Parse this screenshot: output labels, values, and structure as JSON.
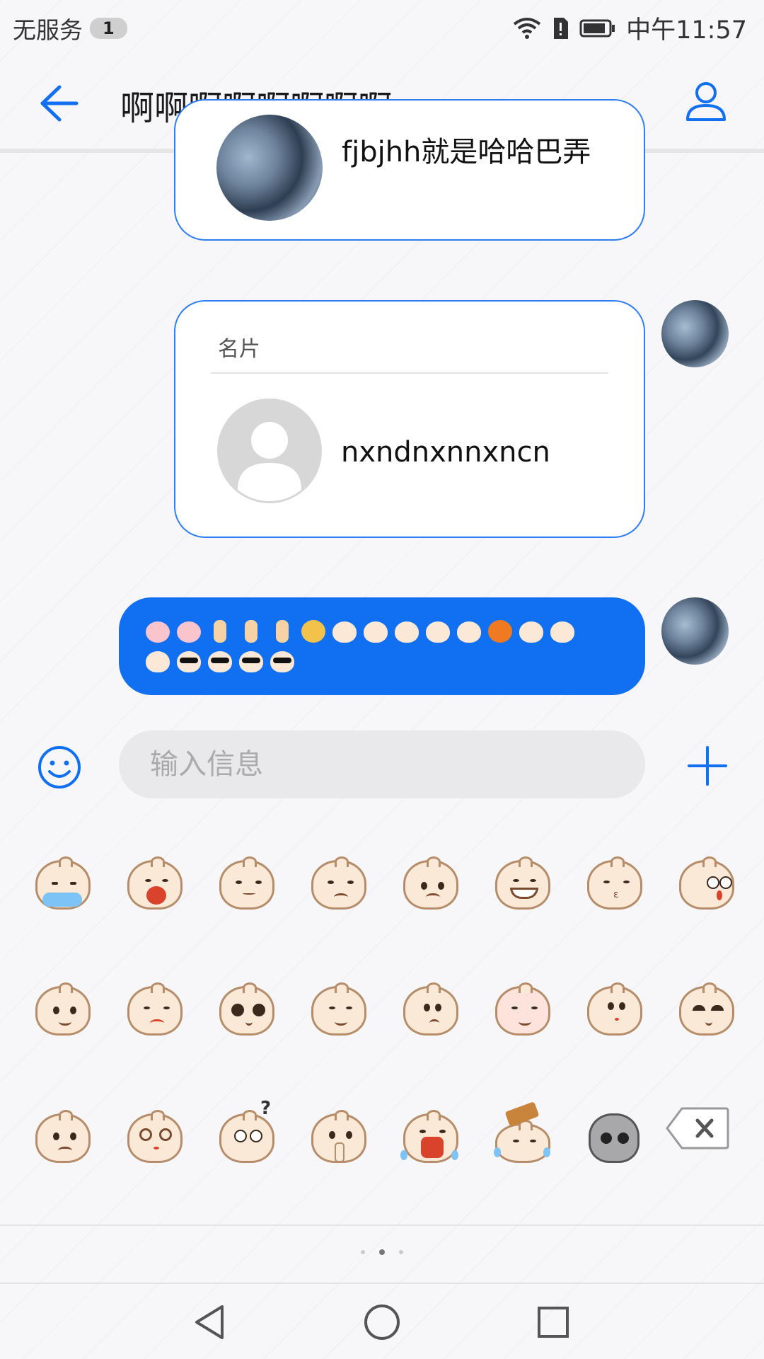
{
  "status_bar": {
    "carrier": "无服务",
    "sim_badge": "1",
    "time": "中午11:57"
  },
  "header": {
    "title": "啊啊啊啊啊啊啊啊",
    "back_icon": "arrow-left-icon",
    "contact_icon": "person-icon"
  },
  "messages": [
    {
      "type": "contact_card",
      "partial_text": "fjbjhh就是哈哈巴弄"
    },
    {
      "type": "contact_card",
      "label": "名片",
      "name": "nxndnxnnxncn"
    },
    {
      "type": "emoji_text",
      "lines": [
        15,
        5
      ]
    }
  ],
  "input": {
    "placeholder": "输入信息",
    "emoji_icon": "smiley-icon",
    "plus_icon": "plus-icon"
  },
  "emoji_panel": {
    "rows": 3,
    "cols": 8,
    "page_dots": 3,
    "active_page": 1
  },
  "colors": {
    "accent": "#1170f2",
    "card_border": "#2e7cf6",
    "background": "#f7f7f9"
  },
  "nav_bar": {
    "back_icon": "triangle-back-icon",
    "home_icon": "circle-home-icon",
    "recent_icon": "square-recent-icon"
  }
}
